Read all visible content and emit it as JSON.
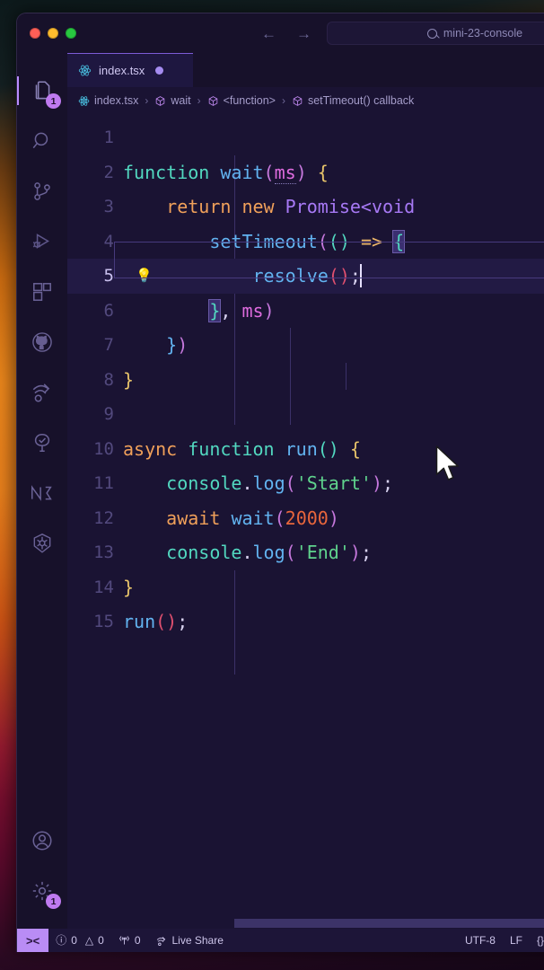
{
  "window": {
    "traffic_lights": [
      "close",
      "minimize",
      "maximize"
    ],
    "project_name": "mini-23-console",
    "search_icon": "search-icon",
    "back_arrow": "←",
    "forward_arrow": "→"
  },
  "activitybar": {
    "items": [
      {
        "name": "explorer",
        "icon": "files-icon",
        "badge": "1",
        "active": true
      },
      {
        "name": "search",
        "icon": "search-icon",
        "badge": "",
        "active": false
      },
      {
        "name": "source-control",
        "icon": "source-control-icon",
        "badge": "",
        "active": false
      },
      {
        "name": "run-and-debug",
        "icon": "run-debug-icon",
        "badge": "",
        "active": false
      },
      {
        "name": "extensions",
        "icon": "extensions-icon",
        "badge": "",
        "active": false
      },
      {
        "name": "github",
        "icon": "github-icon",
        "badge": "",
        "active": false
      },
      {
        "name": "share",
        "icon": "live-share-icon",
        "badge": "",
        "active": false
      },
      {
        "name": "testing",
        "icon": "testing-beaker-icon",
        "badge": "",
        "active": false
      },
      {
        "name": "nx-console",
        "icon": "nx-icon",
        "badge": "",
        "active": false
      },
      {
        "name": "kubernetes",
        "icon": "kubernetes-icon",
        "badge": "",
        "active": false
      }
    ],
    "bottom_items": [
      {
        "name": "accounts",
        "icon": "account-icon",
        "badge": ""
      },
      {
        "name": "manage",
        "icon": "gear-icon",
        "badge": "1"
      }
    ]
  },
  "tabs": [
    {
      "label": "index.tsx",
      "icon": "react-icon",
      "dirty": true,
      "active": true
    }
  ],
  "breadcrumbs": [
    {
      "label": "index.tsx",
      "icon": "react-icon"
    },
    {
      "label": "wait",
      "icon": "symbol-method-icon"
    },
    {
      "label": "<function>",
      "icon": "symbol-method-icon"
    },
    {
      "label": "setTimeout() callback",
      "icon": "symbol-method-icon"
    }
  ],
  "editor": {
    "active_line": 5,
    "lightbulb_line": 5,
    "language": "typescriptreact",
    "lines": [
      {
        "n": "1",
        "text": ""
      },
      {
        "n": "2",
        "text": "function wait(ms) {"
      },
      {
        "n": "3",
        "text": "    return new Promise<void"
      },
      {
        "n": "4",
        "text": "        setTimeout(() => {"
      },
      {
        "n": "5",
        "text": "            resolve();"
      },
      {
        "n": "6",
        "text": "        }, ms)"
      },
      {
        "n": "7",
        "text": "    })"
      },
      {
        "n": "8",
        "text": "}"
      },
      {
        "n": "9",
        "text": ""
      },
      {
        "n": "10",
        "text": "async function run() {"
      },
      {
        "n": "11",
        "text": "    console.log('Start');"
      },
      {
        "n": "12",
        "text": "    await wait(2000)"
      },
      {
        "n": "13",
        "text": "    console.log('End');"
      },
      {
        "n": "14",
        "text": "}"
      },
      {
        "n": "15",
        "text": "run();"
      }
    ]
  },
  "statusbar": {
    "remote_label": "><",
    "errors_icon": "error-circle-icon",
    "errors": "0",
    "warnings_icon": "warning-triangle-icon",
    "warnings": "0",
    "ports_icon": "radio-tower-icon",
    "ports": "0",
    "live_share_icon": "live-share-icon",
    "live_share": "Live Share",
    "encoding": "UTF-8",
    "eol": "LF",
    "language_icon": "{}"
  },
  "colors": {
    "accent": "#b98cf5",
    "editor_bg": "#1a1333",
    "chrome_bg": "#17112a",
    "tab_active": "#1e1740",
    "active_line": "#221a44"
  }
}
